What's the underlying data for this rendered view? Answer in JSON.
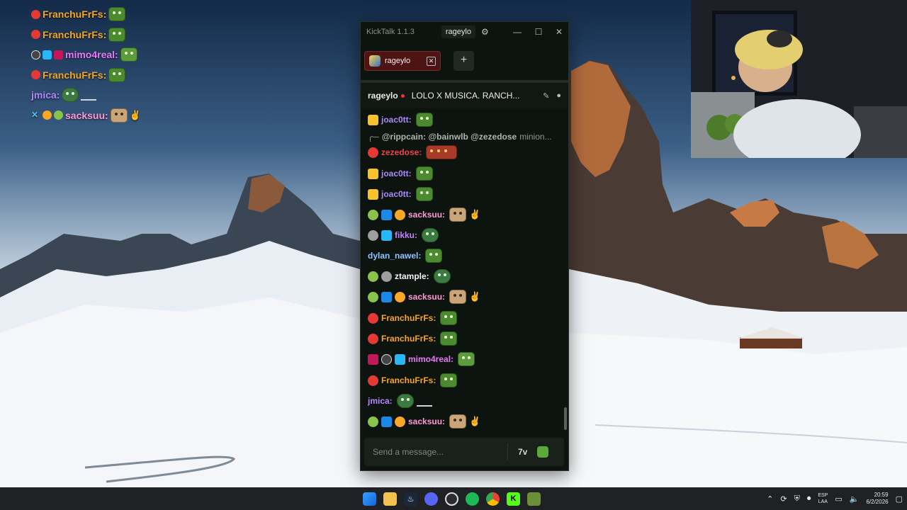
{
  "overlay": [
    {
      "user": "FranchuFrFs:",
      "color": "#f5a623"
    },
    {
      "user": "FranchuFrFs:",
      "color": "#f5a623"
    },
    {
      "user": "mimo4real:",
      "color": "#e879f9"
    },
    {
      "user": "FranchuFrFs:",
      "color": "#f5a623"
    },
    {
      "user": "jmica:",
      "color": "#b388ff"
    },
    {
      "user": "sacksuu:",
      "color": "#ff9ad5"
    }
  ],
  "app": {
    "title": "KickTalk 1.1.3",
    "current_user": "rageylo",
    "tab_label": "rageylo",
    "add_tab": "+"
  },
  "stream": {
    "channel": "rageylo",
    "title": "LOLO X MUSICA. RANCH..."
  },
  "chat": {
    "reply": {
      "mentions": "@rippcain: @bainwlb @zezedose",
      "text": " minion..."
    },
    "messages": [
      {
        "user": "joac0tt:",
        "color": "#a78bfa"
      },
      {
        "user": "zezedose:",
        "color": "#ef4444"
      },
      {
        "user": "joac0tt:",
        "color": "#a78bfa"
      },
      {
        "user": "joac0tt:",
        "color": "#a78bfa"
      },
      {
        "user": "sacksuu:",
        "color": "#ff9ad5"
      },
      {
        "user": "fikku:",
        "color": "#c084fc"
      },
      {
        "user": "dylan_nawel:",
        "color": "#93c5fd"
      },
      {
        "user": "ztample:",
        "color": "#f3f4f6"
      },
      {
        "user": "sacksuu:",
        "color": "#ff9ad5"
      },
      {
        "user": "FranchuFrFs:",
        "color": "#f5a623"
      },
      {
        "user": "FranchuFrFs:",
        "color": "#f5a623"
      },
      {
        "user": "mimo4real:",
        "color": "#e879f9"
      },
      {
        "user": "FranchuFrFs:",
        "color": "#f5a623"
      },
      {
        "user": "jmica:",
        "color": "#b388ff"
      },
      {
        "user": "sacksuu:",
        "color": "#ff9ad5"
      }
    ]
  },
  "input": {
    "placeholder": "Send a message...",
    "kick_label": "7v"
  },
  "taskbar": {
    "lang_top": "ESP",
    "lang_bottom": "LAA",
    "time": "20:59",
    "date": "6/2/2026"
  },
  "colors": {
    "accent": "#53fc18",
    "tab_bg": "#4c1514",
    "window_bg": "#0d130e"
  }
}
